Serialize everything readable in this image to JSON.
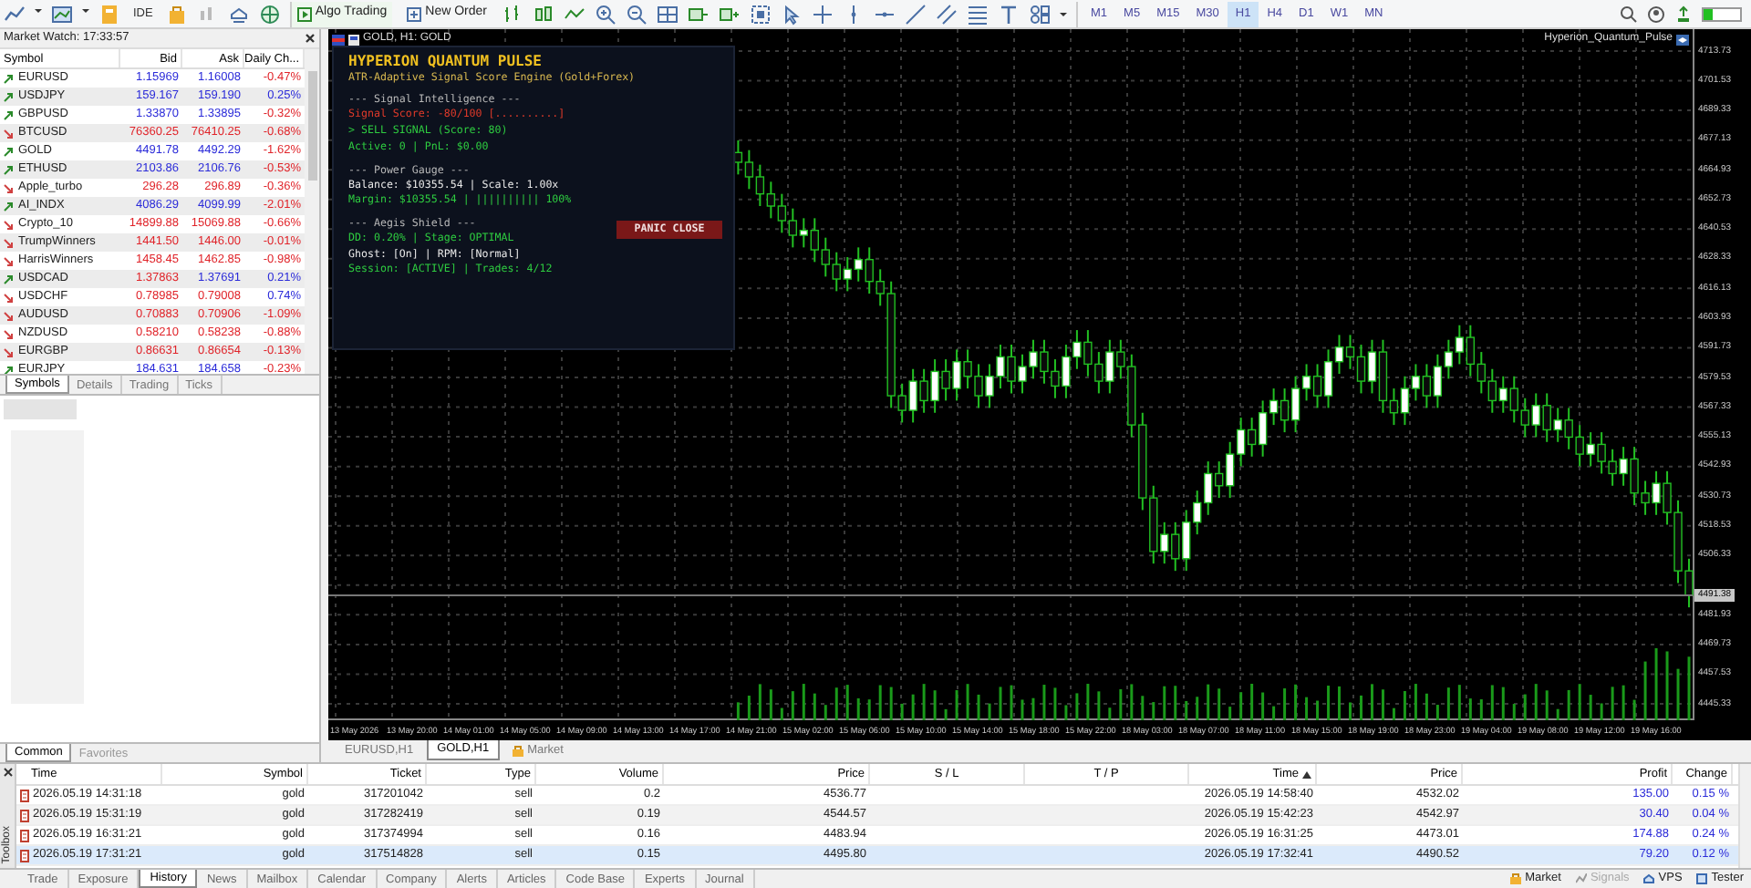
{
  "toolbar": {
    "ide": "IDE",
    "algo_trading": "Algo Trading",
    "new_order": "New Order",
    "timeframes": [
      {
        "label": "M1",
        "selected": false
      },
      {
        "label": "M5",
        "selected": false
      },
      {
        "label": "M15",
        "selected": false
      },
      {
        "label": "M30",
        "selected": false
      },
      {
        "label": "H1",
        "selected": true
      },
      {
        "label": "H4",
        "selected": false
      },
      {
        "label": "D1",
        "selected": false
      },
      {
        "label": "W1",
        "selected": false
      },
      {
        "label": "MN",
        "selected": false
      }
    ]
  },
  "market_watch": {
    "title": "Market Watch: 17:33:57",
    "columns": [
      "Symbol",
      "Bid",
      "Ask",
      "Daily Ch..."
    ],
    "rows": [
      {
        "symbol": "EURUSD",
        "trend_up": true,
        "bid": "1.15969",
        "bid_up": true,
        "ask": "1.16008",
        "ask_up": true,
        "change": "-0.47%",
        "change_up": false
      },
      {
        "symbol": "USDJPY",
        "trend_up": true,
        "bid": "159.167",
        "bid_up": true,
        "ask": "159.190",
        "ask_up": true,
        "change": "0.25%",
        "change_up": true
      },
      {
        "symbol": "GBPUSD",
        "trend_up": true,
        "bid": "1.33870",
        "bid_up": true,
        "ask": "1.33895",
        "ask_up": true,
        "change": "-0.32%",
        "change_up": false
      },
      {
        "symbol": "BTCUSD",
        "trend_up": false,
        "bid": "76360.25",
        "bid_up": false,
        "ask": "76410.25",
        "ask_up": false,
        "change": "-0.68%",
        "change_up": false
      },
      {
        "symbol": "GOLD",
        "trend_up": true,
        "bid": "4491.78",
        "bid_up": true,
        "ask": "4492.29",
        "ask_up": true,
        "change": "-1.62%",
        "change_up": false
      },
      {
        "symbol": "ETHUSD",
        "trend_up": true,
        "bid": "2103.86",
        "bid_up": true,
        "ask": "2106.76",
        "ask_up": true,
        "change": "-0.53%",
        "change_up": false
      },
      {
        "symbol": "Apple_turbo",
        "trend_up": false,
        "bid": "296.28",
        "bid_up": false,
        "ask": "296.89",
        "ask_up": false,
        "change": "-0.36%",
        "change_up": false
      },
      {
        "symbol": "AI_INDX",
        "trend_up": true,
        "bid": "4086.29",
        "bid_up": true,
        "ask": "4099.99",
        "ask_up": true,
        "change": "-2.01%",
        "change_up": false
      },
      {
        "symbol": "Crypto_10",
        "trend_up": false,
        "bid": "14899.88",
        "bid_up": false,
        "ask": "15069.88",
        "ask_up": false,
        "change": "-0.66%",
        "change_up": false
      },
      {
        "symbol": "TrumpWinners",
        "trend_up": false,
        "bid": "1441.50",
        "bid_up": false,
        "ask": "1446.00",
        "ask_up": false,
        "change": "-0.01%",
        "change_up": false
      },
      {
        "symbol": "HarrisWinners",
        "trend_up": false,
        "bid": "1458.45",
        "bid_up": false,
        "ask": "1462.85",
        "ask_up": false,
        "change": "-0.98%",
        "change_up": false
      },
      {
        "symbol": "USDCAD",
        "trend_up": true,
        "bid": "1.37863",
        "bid_up": false,
        "ask": "1.37691",
        "ask_up": true,
        "change": "0.21%",
        "change_up": true
      },
      {
        "symbol": "USDCHF",
        "trend_up": false,
        "bid": "0.78985",
        "bid_up": false,
        "ask": "0.79008",
        "ask_up": false,
        "change": "0.74%",
        "change_up": true
      },
      {
        "symbol": "AUDUSD",
        "trend_up": false,
        "bid": "0.70883",
        "bid_up": false,
        "ask": "0.70906",
        "ask_up": false,
        "change": "-1.09%",
        "change_up": false
      },
      {
        "symbol": "NZDUSD",
        "trend_up": false,
        "bid": "0.58210",
        "bid_up": false,
        "ask": "0.58238",
        "ask_up": false,
        "change": "-0.88%",
        "change_up": false
      },
      {
        "symbol": "EURGBP",
        "trend_up": false,
        "bid": "0.86631",
        "bid_up": false,
        "ask": "0.86654",
        "ask_up": false,
        "change": "-0.13%",
        "change_up": false
      },
      {
        "symbol": "EURJPY",
        "trend_up": true,
        "bid": "184.631",
        "bid_up": true,
        "ask": "184.658",
        "ask_up": true,
        "change": "-0.23%",
        "change_up": false
      }
    ],
    "tabs": [
      {
        "label": "Symbols",
        "selected": true
      },
      {
        "label": "Details",
        "selected": false
      },
      {
        "label": "Trading",
        "selected": false
      },
      {
        "label": "Ticks",
        "selected": false
      }
    ]
  },
  "navigator": {
    "tabs": [
      {
        "label": "Common",
        "selected": true
      },
      {
        "label": "Favorites",
        "selected": false
      }
    ]
  },
  "chart": {
    "title": "GOLD, H1: GOLD",
    "expert": "Hyperion_Quantum_Pulse",
    "current_price": "4491.38",
    "time_labels": [
      "13 May 2026",
      "13 May 20:00",
      "14 May 01:00",
      "14 May 05:00",
      "14 May 09:00",
      "14 May 13:00",
      "14 May 17:00",
      "14 May 21:00",
      "15 May 02:00",
      "15 May 06:00",
      "15 May 10:00",
      "15 May 14:00",
      "15 May 18:00",
      "15 May 22:00",
      "18 May 03:00",
      "18 May 07:00",
      "18 May 11:00",
      "18 May 15:00",
      "18 May 19:00",
      "18 May 23:00",
      "19 May 04:00",
      "19 May 08:00",
      "19 May 12:00",
      "19 May 16:00"
    ],
    "chart_data": {
      "type": "candlestick",
      "ylim": [
        4445.33,
        4713.73
      ],
      "yticks": [
        {
          "value": 4713.73,
          "label": "4713.73"
        },
        {
          "value": 4701.53,
          "label": "4701.53"
        },
        {
          "value": 4689.33,
          "label": "4689.33"
        },
        {
          "value": 4677.13,
          "label": "4677.13"
        },
        {
          "value": 4664.93,
          "label": "4664.93"
        },
        {
          "value": 4652.73,
          "label": "4652.73"
        },
        {
          "value": 4640.53,
          "label": "4640.53"
        },
        {
          "value": 4628.33,
          "label": "4628.33"
        },
        {
          "value": 4616.13,
          "label": "4616.13"
        },
        {
          "value": 4603.93,
          "label": "4603.93"
        },
        {
          "value": 4591.73,
          "label": "4591.73"
        },
        {
          "value": 4579.53,
          "label": "4579.53"
        },
        {
          "value": 4567.33,
          "label": "4567.33"
        },
        {
          "value": 4555.13,
          "label": "4555.13"
        },
        {
          "value": 4542.93,
          "label": "4542.93"
        },
        {
          "value": 4530.73,
          "label": "4530.73"
        },
        {
          "value": 4518.53,
          "label": "4518.53"
        },
        {
          "value": 4506.33,
          "label": "4506.33"
        },
        {
          "value": 4481.93,
          "label": "4481.93"
        },
        {
          "value": 4469.73,
          "label": "4469.73"
        },
        {
          "value": 4457.53,
          "label": "4457.53"
        },
        {
          "value": 4445.33,
          "label": "4445.33"
        }
      ],
      "grid": true,
      "categories": [
        null,
        null,
        null,
        null,
        null,
        null,
        null,
        null,
        null,
        null,
        null,
        null,
        null,
        null,
        null,
        null,
        null,
        null,
        null,
        null,
        null,
        null,
        null,
        null,
        null,
        null,
        null,
        null,
        null,
        null,
        null,
        null,
        null,
        null,
        null,
        null,
        null,
        null,
        null,
        null,
        null,
        null,
        null,
        null,
        null,
        null,
        null,
        null,
        null,
        null,
        null,
        null,
        null,
        null,
        null,
        null,
        null,
        null,
        null,
        null,
        null,
        null,
        null,
        null,
        null,
        null,
        null,
        null,
        null,
        null,
        null,
        null,
        null,
        null,
        null,
        null,
        null,
        null,
        null,
        null,
        null,
        null,
        null,
        null,
        null,
        null,
        null,
        null,
        null,
        null,
        null,
        null,
        null,
        null,
        null,
        null,
        null,
        null,
        null,
        null,
        null,
        null,
        null,
        null,
        null,
        null,
        null,
        null,
        null,
        null,
        null,
        null,
        null,
        null,
        null,
        null,
        null,
        null,
        null,
        null,
        null,
        null,
        null,
        null,
        null
      ],
      "ohlc": [
        null,
        null,
        null,
        null,
        null,
        null,
        null,
        null,
        null,
        null,
        null,
        null,
        null,
        null,
        null,
        null,
        null,
        null,
        null,
        null,
        null,
        null,
        null,
        null,
        null,
        null,
        null,
        null,
        null,
        null,
        null,
        null,
        null,
        null,
        null,
        null,
        null,
        [
          4672,
          4677,
          4663,
          4668
        ],
        [
          4668,
          4673,
          4657,
          4662
        ],
        [
          4662,
          4667,
          4650,
          4655
        ],
        [
          4655,
          4660,
          4645,
          4650
        ],
        [
          4650,
          4655,
          4639,
          4644
        ],
        [
          4644,
          4649,
          4633,
          4638
        ],
        [
          4638,
          4645,
          4633,
          4640
        ],
        [
          4640,
          4645,
          4627,
          4632
        ],
        [
          4632,
          4637,
          4621,
          4626
        ],
        [
          4626,
          4631,
          4615,
          4620
        ],
        [
          4620,
          4629,
          4615,
          4624
        ],
        [
          4624,
          4633,
          4619,
          4628
        ],
        [
          4628,
          4633,
          4614,
          4619
        ],
        [
          4619,
          4624,
          4609,
          4614
        ],
        [
          4614,
          4619,
          4567,
          4572
        ],
        [
          4572,
          4577,
          4561,
          4566
        ],
        [
          4566,
          4583,
          4561,
          4578
        ],
        [
          4578,
          4583,
          4565,
          4570
        ],
        [
          4570,
          4587,
          4565,
          4582
        ],
        [
          4582,
          4587,
          4570,
          4575
        ],
        [
          4575,
          4591,
          4570,
          4586
        ],
        [
          4586,
          4591,
          4575,
          4580
        ],
        [
          4580,
          4585,
          4567,
          4572
        ],
        [
          4572,
          4585,
          4567,
          4580
        ],
        [
          4580,
          4593,
          4575,
          4588
        ],
        [
          4588,
          4593,
          4573,
          4578
        ],
        [
          4578,
          4589,
          4573,
          4584
        ],
        [
          4584,
          4595,
          4579,
          4590
        ],
        [
          4590,
          4595,
          4577,
          4582
        ],
        [
          4582,
          4587,
          4571,
          4576
        ],
        [
          4576,
          4593,
          4571,
          4588
        ],
        [
          4588,
          4599,
          4583,
          4594
        ],
        [
          4594,
          4599,
          4580,
          4585
        ],
        [
          4585,
          4590,
          4573,
          4578
        ],
        [
          4578,
          4595,
          4573,
          4590
        ],
        [
          4590,
          4595,
          4579,
          4584
        ],
        [
          4584,
          4589,
          4555,
          4560
        ],
        [
          4560,
          4565,
          4525,
          4530
        ],
        [
          4530,
          4535,
          4503,
          4508
        ],
        [
          4508,
          4520,
          4503,
          4515
        ],
        [
          4515,
          4520,
          4500,
          4505
        ],
        [
          4505,
          4525,
          4500,
          4520
        ],
        [
          4520,
          4533,
          4515,
          4528
        ],
        [
          4528,
          4545,
          4523,
          4540
        ],
        [
          4540,
          4545,
          4530,
          4535
        ],
        [
          4535,
          4553,
          4530,
          4548
        ],
        [
          4548,
          4563,
          4543,
          4558
        ],
        [
          4558,
          4563,
          4547,
          4552
        ],
        [
          4552,
          4570,
          4547,
          4565
        ],
        [
          4565,
          4575,
          4560,
          4570
        ],
        [
          4570,
          4575,
          4557,
          4562
        ],
        [
          4562,
          4580,
          4557,
          4575
        ],
        [
          4575,
          4585,
          4570,
          4580
        ],
        [
          4580,
          4585,
          4567,
          4572
        ],
        [
          4572,
          4591,
          4567,
          4586
        ],
        [
          4586,
          4597,
          4581,
          4592
        ],
        [
          4592,
          4597,
          4583,
          4588
        ],
        [
          4588,
          4593,
          4573,
          4578
        ],
        [
          4578,
          4595,
          4573,
          4590
        ],
        [
          4590,
          4595,
          4565,
          4570
        ],
        [
          4570,
          4575,
          4560,
          4565
        ],
        [
          4565,
          4580,
          4560,
          4575
        ],
        [
          4575,
          4585,
          4570,
          4580
        ],
        [
          4580,
          4585,
          4567,
          4572
        ],
        [
          4572,
          4589,
          4567,
          4584
        ],
        [
          4584,
          4595,
          4579,
          4590
        ],
        [
          4590,
          4601,
          4585,
          4596
        ],
        [
          4596,
          4601,
          4580,
          4585
        ],
        [
          4585,
          4590,
          4573,
          4578
        ],
        [
          4578,
          4583,
          4565,
          4570
        ],
        [
          4570,
          4580,
          4565,
          4575
        ],
        [
          4575,
          4580,
          4561,
          4566
        ],
        [
          4566,
          4571,
          4555,
          4560
        ],
        [
          4560,
          4573,
          4555,
          4568
        ],
        [
          4568,
          4573,
          4553,
          4558
        ],
        [
          4558,
          4567,
          4553,
          4562
        ],
        [
          4562,
          4567,
          4550,
          4555
        ],
        [
          4555,
          4560,
          4543,
          4548
        ],
        [
          4548,
          4557,
          4543,
          4552
        ],
        [
          4552,
          4557,
          4540,
          4545
        ],
        [
          4545,
          4550,
          4535,
          4540
        ],
        [
          4540,
          4551,
          4535,
          4546
        ],
        [
          4546,
          4551,
          4527,
          4532
        ],
        [
          4532,
          4537,
          4523,
          4528
        ],
        [
          4528,
          4541,
          4523,
          4536
        ],
        [
          4536,
          4541,
          4519,
          4524
        ],
        [
          4524,
          4529,
          4495,
          4500
        ],
        [
          4500,
          4505,
          4485,
          4490
        ]
      ]
    },
    "panel": {
      "lines": [
        {
          "kind": "title",
          "text": "HYPERION QUANTUM PULSE"
        },
        {
          "kind": "subtitle",
          "text": "ATR-Adaptive Signal Score Engine (Gold+Forex)"
        },
        {
          "kind": "heading",
          "text": "--- Signal Intelligence ---"
        },
        {
          "kind": "alert",
          "text": "Signal Score: -80/100 [..........]"
        },
        {
          "kind": "good",
          "text": "> SELL SIGNAL (Score: 80)"
        },
        {
          "kind": "good",
          "text": "Active: 0 | PnL: $0.00"
        },
        {
          "kind": "heading",
          "text": "--- Power Gauge ---"
        },
        {
          "kind": "plain",
          "text": "Balance: $10355.54 | Scale: 1.00x"
        },
        {
          "kind": "good",
          "text": "Margin: $10355.54 | |||||||||| 100%"
        },
        {
          "kind": "heading",
          "text": "--- Aegis Shield ---"
        },
        {
          "kind": "good",
          "text": "DD: 0.20% | Stage: OPTIMAL"
        },
        {
          "kind": "plain",
          "text": "Ghost: [On] | RPM: [Normal]"
        },
        {
          "kind": "good",
          "text": "Session: [ACTIVE] | Trades: 4/12"
        }
      ],
      "button": "PANIC CLOSE"
    },
    "tabs": [
      {
        "label": "EURUSD,H1",
        "selected": false
      },
      {
        "label": "GOLD,H1",
        "selected": true
      },
      {
        "label": "Market",
        "selected": false
      }
    ]
  },
  "toolbox": {
    "label": "Toolbox",
    "columns": [
      {
        "label": "Time",
        "sorted": false
      },
      {
        "label": "Symbol",
        "sorted": false
      },
      {
        "label": "Ticket",
        "sorted": false
      },
      {
        "label": "Type",
        "sorted": false
      },
      {
        "label": "Volume",
        "sorted": false
      },
      {
        "label": "Price",
        "sorted": false
      },
      {
        "label": "S / L",
        "sorted": false
      },
      {
        "label": "T / P",
        "sorted": false
      },
      {
        "label": "Time",
        "sorted": true
      },
      {
        "label": "Price",
        "sorted": false
      },
      {
        "label": "Profit",
        "sorted": false
      },
      {
        "label": "Change",
        "sorted": false
      }
    ],
    "rows": [
      {
        "selected": false,
        "cells": [
          "2026.05.19 14:31:18",
          "gold",
          "317201042",
          "sell",
          "0.2",
          "4536.77",
          "",
          "",
          "2026.05.19 14:58:40",
          "4532.02",
          "135.00",
          "0.15 %"
        ]
      },
      {
        "selected": false,
        "cells": [
          "2026.05.19 15:31:19",
          "gold",
          "317282419",
          "sell",
          "0.19",
          "4544.57",
          "",
          "",
          "2026.05.19 15:42:23",
          "4542.97",
          "30.40",
          "0.04 %"
        ]
      },
      {
        "selected": false,
        "cells": [
          "2026.05.19 16:31:21",
          "gold",
          "317374994",
          "sell",
          "0.16",
          "4483.94",
          "",
          "",
          "2026.05.19 16:31:25",
          "4473.01",
          "174.88",
          "0.24 %"
        ]
      },
      {
        "selected": true,
        "cells": [
          "2026.05.19 17:31:21",
          "gold",
          "317514828",
          "sell",
          "0.15",
          "4495.80",
          "",
          "",
          "2026.05.19 17:32:41",
          "4490.52",
          "79.20",
          "0.12 %"
        ]
      }
    ],
    "tabs": [
      {
        "label": "Trade",
        "selected": false
      },
      {
        "label": "Exposure",
        "selected": false
      },
      {
        "label": "History",
        "selected": true
      },
      {
        "label": "News",
        "selected": false
      },
      {
        "label": "Mailbox",
        "selected": false
      },
      {
        "label": "Calendar",
        "selected": false
      },
      {
        "label": "Company",
        "selected": false
      },
      {
        "label": "Alerts",
        "selected": false
      },
      {
        "label": "Articles",
        "selected": false
      },
      {
        "label": "Code Base",
        "selected": false
      },
      {
        "label": "Experts",
        "selected": false
      },
      {
        "label": "Journal",
        "selected": false
      }
    ],
    "status_items": [
      {
        "label": "Market",
        "disabled": false
      },
      {
        "label": "Signals",
        "disabled": true
      },
      {
        "label": "VPS",
        "disabled": false
      },
      {
        "label": "Tester",
        "disabled": false
      }
    ]
  }
}
